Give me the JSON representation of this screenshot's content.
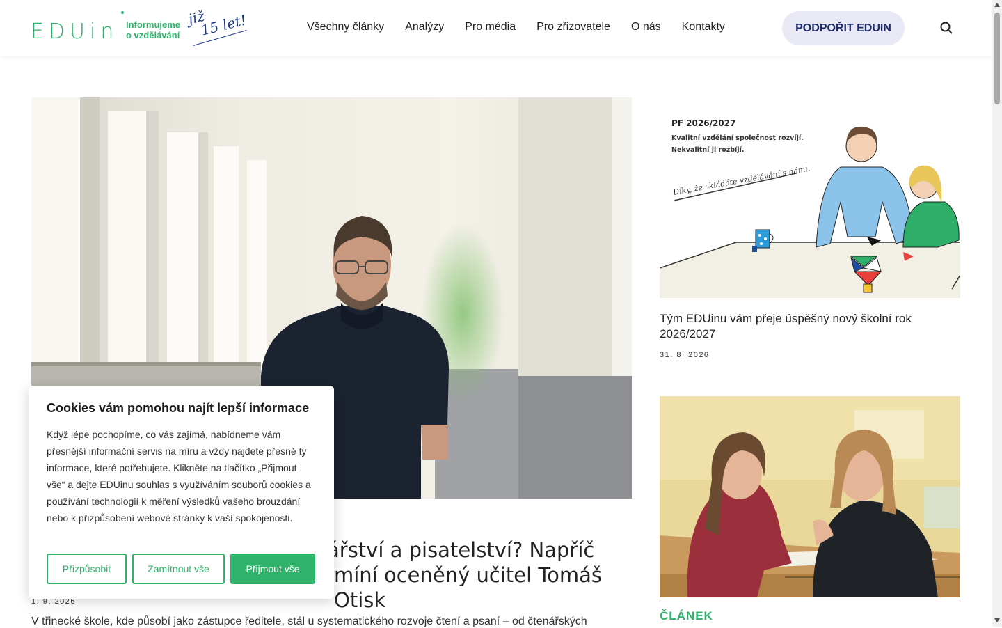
{
  "header": {
    "logo_text": "EDUin",
    "tagline_line1": "Informujeme",
    "tagline_line2": "o vzdělávání",
    "handwriting_line1": "již",
    "handwriting_line2": "15 let!",
    "nav": [
      {
        "label": "Všechny články"
      },
      {
        "label": "Analýzy"
      },
      {
        "label": "Pro média"
      },
      {
        "label": "Pro zřizovatele"
      },
      {
        "label": "O nás"
      },
      {
        "label": "Kontakty"
      }
    ],
    "support_label": "PODPOŘIT EDUIN",
    "search_icon": "search-icon"
  },
  "main_article": {
    "title_visible": "ářství a pisatelství? Napříč\nmíní oceněný učitel Tomáš Otisk",
    "date": "1. 9. 2026",
    "excerpt": "V třinecké škole, kde působí jako zástupce ředitele, stál u systematického rozvoje čtení a psaní – od čtenářských"
  },
  "sidebar": {
    "card1": {
      "image_text": {
        "pf": "PF 2026/2027",
        "line1": "Kvalitní vzdělání společnost rozvíjí.",
        "line2": "Nekvalitní ji rozbíjí.",
        "script": "Díky, že skládáte vzdělávání s námi."
      },
      "title": "Tým EDUinu vám přeje úspěšný nový školní rok 2026/2027",
      "date": "31. 8. 2026"
    },
    "card2": {
      "category": "ČLÁNEK"
    }
  },
  "cookie": {
    "title": "Cookies vám pomohou najít lepší informace",
    "text": "Když lépe pochopíme, co vás zajímá, nabídneme vám přesnější informační servis na míru a vždy najdete přesně ty informace, které potřebujete. Klikněte na tlačítko „Přijmout vše“ a dejte EDUinu souhlas s využíváním souborů cookies a používání technologií k měření výsledků vašeho brouzdání nebo k přizpůsobení webové stránky k vaší spokojenosti.",
    "customize_label": "Přizpůsobit",
    "reject_label": "Zamítnout vše",
    "accept_label": "Přijmout vše"
  },
  "colors": {
    "brand_green": "#2fb36b",
    "brand_navy": "#1d2b6b",
    "support_bg": "#e8e9f5"
  }
}
